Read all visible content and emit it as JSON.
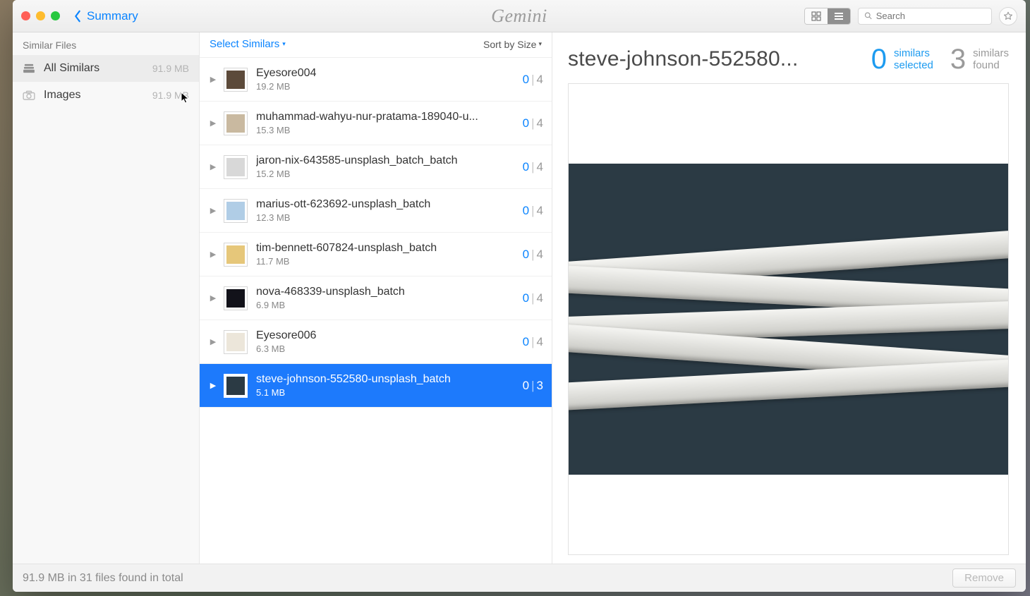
{
  "titlebar": {
    "back_label": "Summary",
    "app_name": "Gemini",
    "search_placeholder": "Search"
  },
  "sidebar": {
    "header": "Similar Files",
    "items": [
      {
        "icon": "stack-icon",
        "name": "All Similars",
        "size": "91.9 MB",
        "active": true
      },
      {
        "icon": "camera-icon",
        "name": "Images",
        "size": "91.9 MB",
        "active": false
      }
    ]
  },
  "midcol": {
    "select_label": "Select Similars",
    "sort_label": "Sort by Size",
    "rows": [
      {
        "name": "Eyesore004",
        "size": "19.2 MB",
        "sel": "0",
        "tot": "4",
        "thumb": "#5c4a3a",
        "selected": false
      },
      {
        "name": "muhammad-wahyu-nur-pratama-189040-u...",
        "size": "15.3 MB",
        "sel": "0",
        "tot": "4",
        "thumb": "#c9b9a0",
        "selected": false
      },
      {
        "name": "jaron-nix-643585-unsplash_batch_batch",
        "size": "15.2 MB",
        "sel": "0",
        "tot": "4",
        "thumb": "#d8d8d8",
        "selected": false
      },
      {
        "name": "marius-ott-623692-unsplash_batch",
        "size": "12.3 MB",
        "sel": "0",
        "tot": "4",
        "thumb": "#b0cde6",
        "selected": false
      },
      {
        "name": "tim-bennett-607824-unsplash_batch",
        "size": "11.7 MB",
        "sel": "0",
        "tot": "4",
        "thumb": "#e6c77a",
        "selected": false
      },
      {
        "name": "nova-468339-unsplash_batch",
        "size": "6.9 MB",
        "sel": "0",
        "tot": "4",
        "thumb": "#12121a",
        "selected": false
      },
      {
        "name": "Eyesore006",
        "size": "6.3 MB",
        "sel": "0",
        "tot": "4",
        "thumb": "#ece6da",
        "selected": false
      },
      {
        "name": "steve-johnson-552580-unsplash_batch",
        "size": "5.1 MB",
        "sel": "0",
        "tot": "3",
        "thumb": "#2b3a44",
        "selected": true
      }
    ]
  },
  "detail": {
    "title": "steve-johnson-552580...",
    "selected_count": "0",
    "selected_l1": "similars",
    "selected_l2": "selected",
    "found_count": "3",
    "found_l1": "similars",
    "found_l2": "found"
  },
  "footer": {
    "status": "91.9 MB in 31 files found in total",
    "remove_label": "Remove"
  }
}
